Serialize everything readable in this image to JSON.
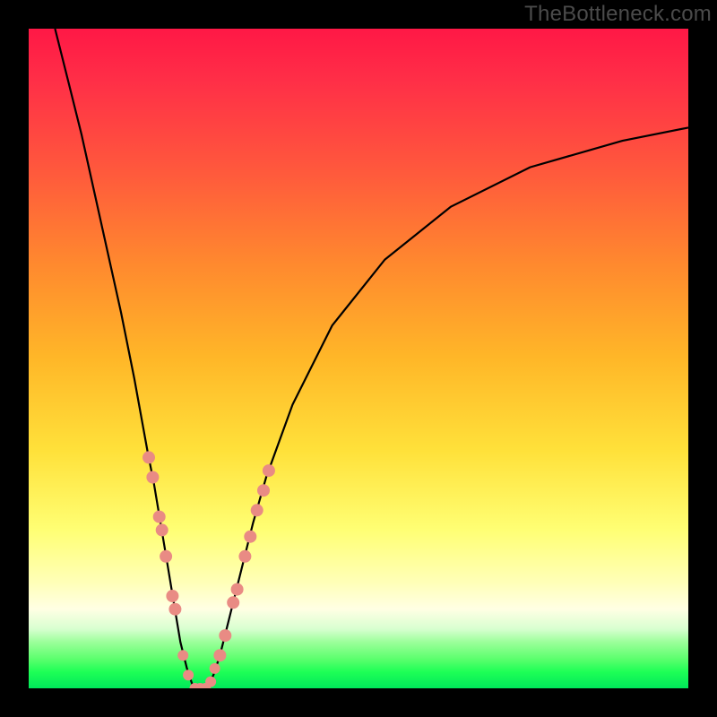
{
  "watermark": "TheBottleneck.com",
  "chart_data": {
    "type": "line",
    "title": "",
    "xlabel": "",
    "ylabel": "",
    "xlim": [
      0,
      100
    ],
    "ylim": [
      0,
      100
    ],
    "series": [
      {
        "name": "bottleneck-curve",
        "x": [
          4,
          6,
          8,
          10,
          12,
          14,
          16,
          18,
          19,
          20,
          21,
          22,
          23,
          24,
          25,
          26,
          27,
          28,
          29,
          30,
          32,
          34,
          36,
          40,
          46,
          54,
          64,
          76,
          90,
          100
        ],
        "y": [
          100,
          92,
          84,
          75,
          66,
          57,
          47,
          36,
          31,
          25,
          19,
          13,
          7,
          3,
          0,
          0,
          0,
          2,
          5,
          9,
          17,
          25,
          32,
          43,
          55,
          65,
          73,
          79,
          83,
          85
        ]
      }
    ],
    "left_highlight_points": [
      {
        "x": 18.2,
        "y": 35
      },
      {
        "x": 18.8,
        "y": 32
      },
      {
        "x": 19.8,
        "y": 26
      },
      {
        "x": 20.2,
        "y": 24
      },
      {
        "x": 20.8,
        "y": 20
      },
      {
        "x": 21.8,
        "y": 14
      },
      {
        "x": 22.2,
        "y": 12
      }
    ],
    "right_highlight_points": [
      {
        "x": 29.0,
        "y": 5
      },
      {
        "x": 29.8,
        "y": 8
      },
      {
        "x": 31.0,
        "y": 13
      },
      {
        "x": 31.6,
        "y": 15
      },
      {
        "x": 32.8,
        "y": 20
      },
      {
        "x": 33.6,
        "y": 23
      },
      {
        "x": 34.6,
        "y": 27
      },
      {
        "x": 35.6,
        "y": 30
      },
      {
        "x": 36.4,
        "y": 33
      }
    ],
    "valley_highlight_points": [
      {
        "x": 23.4,
        "y": 5
      },
      {
        "x": 24.2,
        "y": 2
      },
      {
        "x": 25.2,
        "y": 0
      },
      {
        "x": 26.0,
        "y": 0
      },
      {
        "x": 26.8,
        "y": 0
      },
      {
        "x": 27.6,
        "y": 1
      },
      {
        "x": 28.2,
        "y": 3
      }
    ],
    "colors": {
      "curve": "#000000",
      "highlight": "#e98b84"
    }
  }
}
